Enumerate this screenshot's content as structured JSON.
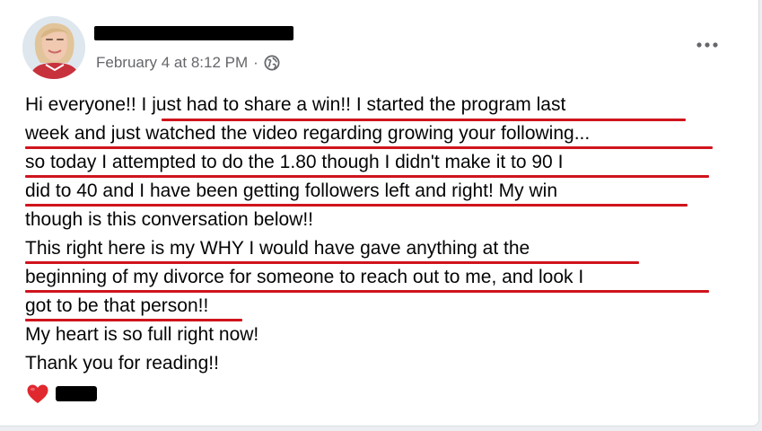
{
  "post": {
    "date": "February 4 at 8:12 PM",
    "separator": "·",
    "audience_icon": "globe-icon",
    "more_icon": "more-horizontal-icon",
    "lines": [
      "Hi everyone!! I just had to share a win!! I started the program last",
      "week and just watched the video regarding growing your following...",
      "so today I attempted to do the 1.80 though I didn't make it to 90 I",
      "did to 40 and I have been getting followers left and right! My win",
      "though is this conversation below!!",
      "This right here is my WHY I would have gave anything at the",
      "beginning of my divorce for someone to reach out to me, and look I",
      "got to be that person!!",
      "My heart is so full right now!",
      "Thank you for reading!!"
    ],
    "emoji": "red-heart-icon"
  },
  "colors": {
    "underline": "#d0141d",
    "meta_text": "#65676b",
    "text": "#050505"
  }
}
